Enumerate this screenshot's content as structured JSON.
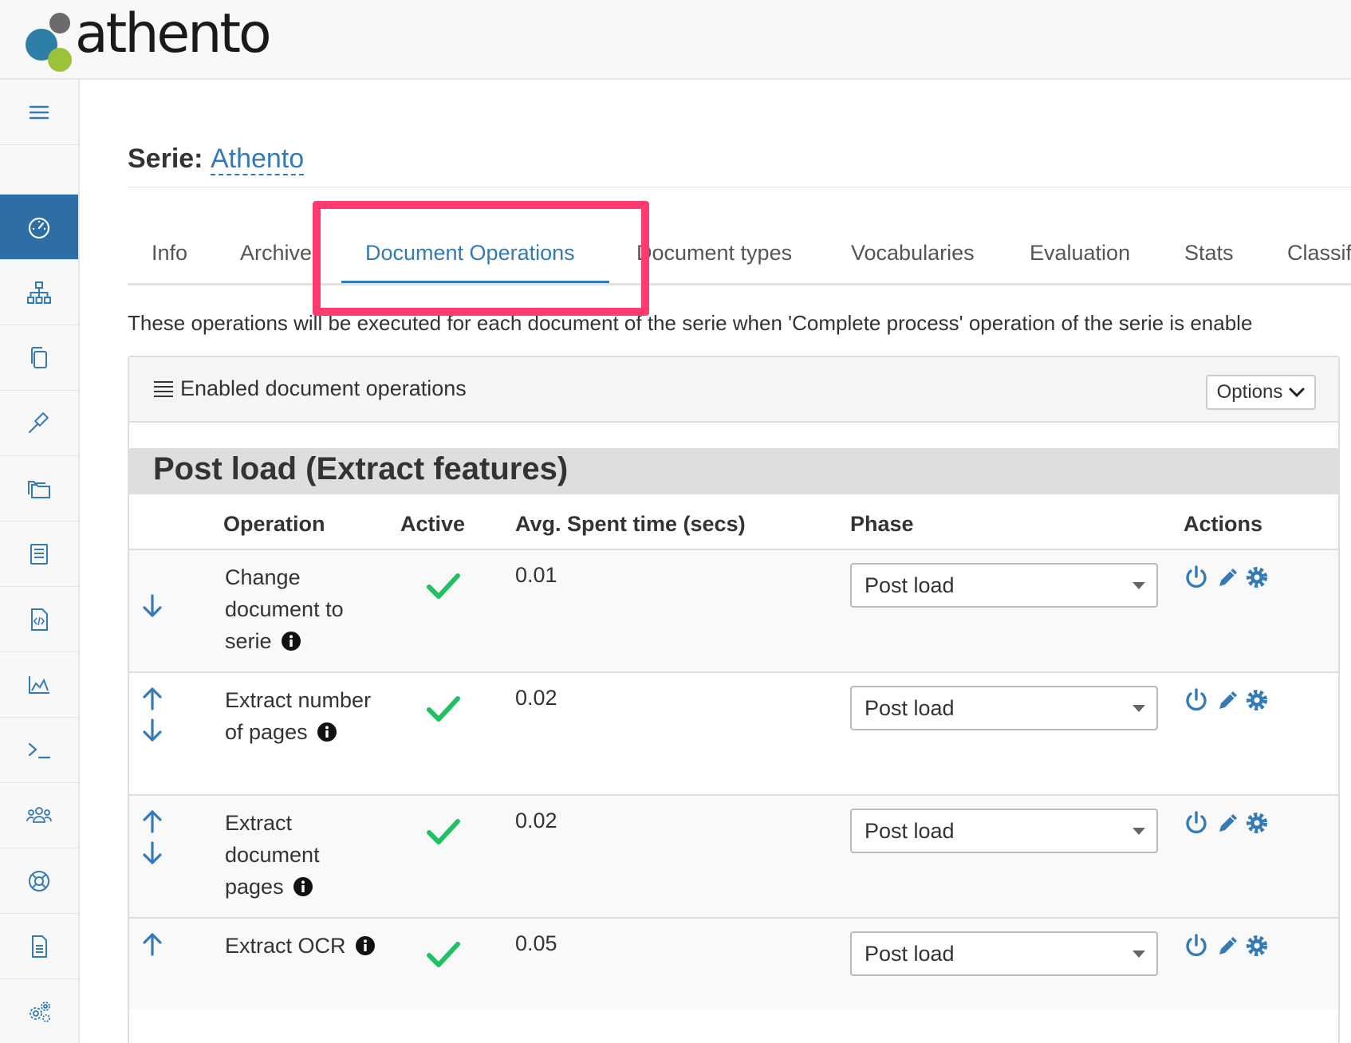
{
  "brand": {
    "logo_text": "athento",
    "colors": {
      "dot_blue": "#2e7fa6",
      "dot_dark": "#6b6b6b",
      "dot_green": "#9bc33a"
    }
  },
  "sidebar": {
    "items": [
      {
        "icon": "menu-icon",
        "active": false
      },
      {
        "icon": "dashboard-icon",
        "active": true
      },
      {
        "icon": "sitemap-icon",
        "active": false
      },
      {
        "icon": "copy-icon",
        "active": false
      },
      {
        "icon": "gavel-icon",
        "active": false
      },
      {
        "icon": "folders-icon",
        "active": false
      },
      {
        "icon": "book-icon",
        "active": false
      },
      {
        "icon": "code-file-icon",
        "active": false
      },
      {
        "icon": "area-chart-icon",
        "active": false
      },
      {
        "icon": "terminal-icon",
        "active": false
      },
      {
        "icon": "users-icon",
        "active": false
      },
      {
        "icon": "lifebuoy-icon",
        "active": false
      },
      {
        "icon": "document-icon",
        "active": false
      },
      {
        "icon": "cogs-icon",
        "active": false
      }
    ],
    "active_color": "#2e6ea6"
  },
  "header": {
    "label": "Serie:",
    "serie_name": "Athento"
  },
  "tabs": [
    {
      "label": "Info",
      "active": false
    },
    {
      "label": "Archive",
      "active": false
    },
    {
      "label": "Document Operations",
      "active": true
    },
    {
      "label": "Document types",
      "active": false
    },
    {
      "label": "Vocabularies",
      "active": false
    },
    {
      "label": "Evaluation",
      "active": false
    },
    {
      "label": "Stats",
      "active": false
    },
    {
      "label": "Classifi",
      "active": false
    }
  ],
  "description": "These operations will be executed for each document of the serie when 'Complete process' operation of the serie is enable",
  "panel": {
    "title": "Enabled document operations",
    "options_label": "Options",
    "group_title": "Post load (Extract features)",
    "columns": {
      "operation": "Operation",
      "active": "Active",
      "avg_time": "Avg. Spent time (secs)",
      "phase": "Phase",
      "actions": "Actions"
    },
    "rows": [
      {
        "operation": "Change document to serie",
        "active": true,
        "avg_time": "0.01",
        "phase": "Post load",
        "move_up": false,
        "move_down": true
      },
      {
        "operation": "Extract number of pages",
        "active": true,
        "avg_time": "0.02",
        "phase": "Post load",
        "move_up": true,
        "move_down": true
      },
      {
        "operation": "Extract document pages",
        "active": true,
        "avg_time": "0.02",
        "phase": "Post load",
        "move_up": true,
        "move_down": false
      },
      {
        "operation": "Extract OCR",
        "active": true,
        "avg_time": "0.05",
        "phase": "Post load",
        "move_up": true,
        "move_down": false
      }
    ]
  },
  "colors": {
    "link": "#337ab7",
    "check_green": "#21c063",
    "highlight": "#ff3a6e"
  }
}
